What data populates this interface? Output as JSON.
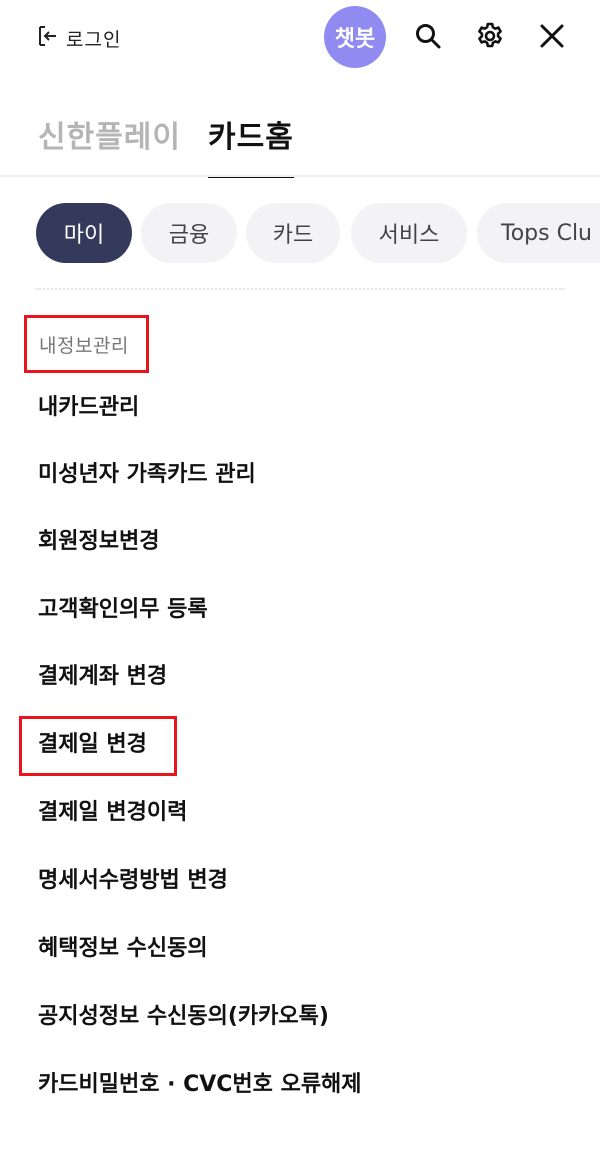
{
  "header": {
    "login_label": "로그인",
    "chatbot_label": "챗봇",
    "icons": [
      "login-icon",
      "search-icon",
      "gear-icon",
      "close-icon"
    ]
  },
  "top_tabs": [
    {
      "label": "신한플레이",
      "active": false
    },
    {
      "label": "카드홈",
      "active": true
    }
  ],
  "chips": [
    {
      "label": "마이",
      "active": true
    },
    {
      "label": "금융",
      "active": false
    },
    {
      "label": "카드",
      "active": false
    },
    {
      "label": "서비스",
      "active": false
    },
    {
      "label": "Tops Clu",
      "active": false
    }
  ],
  "section": {
    "title": "내정보관리",
    "items": [
      "내카드관리",
      "미성년자 가족카드 관리",
      "회원정보변경",
      "고객확인의무 등록",
      "결제계좌 변경",
      "결제일 변경",
      "결제일 변경이력",
      "명세서수령방법 변경",
      "혜택정보 수신동의",
      "공지성정보 수신동의(카카오톡)",
      "카드비밀번호 · CVC번호 오류해제"
    ]
  },
  "colors": {
    "accent_chip": "#333a5c",
    "chatbot": "#8f8bf0",
    "highlight": "#e8141e"
  }
}
